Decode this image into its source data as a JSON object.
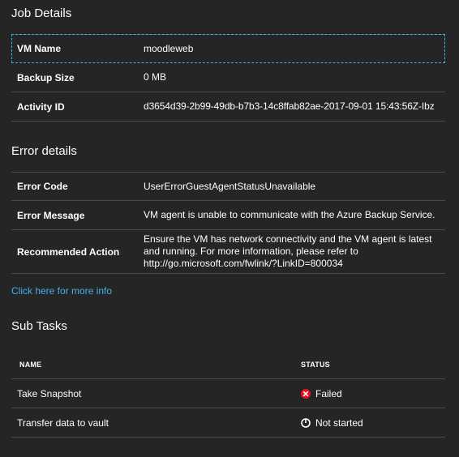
{
  "job_details": {
    "title": "Job Details",
    "rows": [
      {
        "label": "VM Name",
        "value": "moodleweb"
      },
      {
        "label": "Backup Size",
        "value": "0 MB"
      },
      {
        "label": "Activity ID",
        "value": "d3654d39-2b99-49db-b7b3-14c8ffab82ae-2017-09-01 15:43:56Z-Ibz"
      }
    ]
  },
  "error_details": {
    "title": "Error details",
    "rows": [
      {
        "label": "Error Code",
        "value": "UserErrorGuestAgentStatusUnavailable"
      },
      {
        "label": "Error Message",
        "value": "VM agent is unable to communicate with the Azure Backup Service."
      },
      {
        "label": "Recommended Action",
        "value": "Ensure the VM has network connectivity and the VM agent is latest and running. For more information, please refer to http://go.microsoft.com/fwlink/?LinkID=800034"
      }
    ],
    "more_info_link": "Click here for more info"
  },
  "sub_tasks": {
    "title": "Sub Tasks",
    "columns": {
      "name": "NAME",
      "status": "STATUS"
    },
    "rows": [
      {
        "name": "Take Snapshot",
        "status": "Failed",
        "status_icon": "error-icon",
        "status_color": "#e81123"
      },
      {
        "name": "Transfer data to vault",
        "status": "Not started",
        "status_icon": "not-started-icon",
        "status_color": "#ffffff"
      }
    ]
  },
  "colors": {
    "background": "#252526",
    "link": "#3fb4e6",
    "divider": "#4a4a4a",
    "focus_outline": "#3fb4e6"
  }
}
